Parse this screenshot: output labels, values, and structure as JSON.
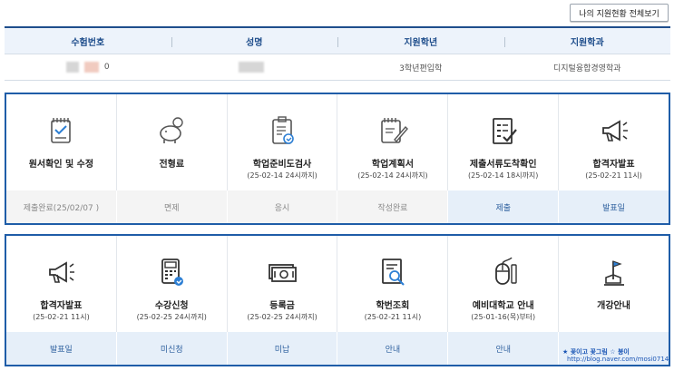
{
  "top_button": "나의 지원현황 전체보기",
  "info": {
    "headers": [
      "수험번호",
      "성명",
      "지원학년",
      "지원학과"
    ],
    "values": {
      "exam_no_suffix": "0",
      "grade": "3학년편입학",
      "dept": "디지털융합경영학과"
    }
  },
  "panel1": [
    {
      "title": "원서확인 및 수정",
      "sub": "",
      "status": "제출완료(25/02/07 )",
      "style": "gray",
      "icon": "clipboard-check-icon"
    },
    {
      "title": "전형료",
      "sub": "",
      "status": "면제",
      "style": "gray",
      "icon": "piggy-bank-icon"
    },
    {
      "title": "학업준비도검사",
      "sub": "(25-02-14 24시까지)",
      "status": "응시",
      "style": "gray",
      "icon": "test-clipboard-icon"
    },
    {
      "title": "학업계획서",
      "sub": "(25-02-14 24시까지)",
      "status": "작성완료",
      "style": "gray",
      "icon": "notepad-pencil-icon"
    },
    {
      "title": "제출서류도착확인",
      "sub": "(25-02-14 18시까지)",
      "status": "제출",
      "style": "blue",
      "icon": "checklist-icon"
    },
    {
      "title": "합격자발표",
      "sub": "(25-02-21 11시)",
      "status": "발표일",
      "style": "blue",
      "icon": "megaphone-icon"
    }
  ],
  "panel2": [
    {
      "title": "합격자발표",
      "sub": "(25-02-21 11시)",
      "status": "발표일",
      "style": "blue",
      "icon": "megaphone-icon"
    },
    {
      "title": "수강신청",
      "sub": "(25-02-25 24시까지)",
      "status": "미신청",
      "style": "blue",
      "icon": "calculator-icon"
    },
    {
      "title": "등록금",
      "sub": "(25-02-25 24시까지)",
      "status": "미납",
      "style": "blue",
      "icon": "money-icon"
    },
    {
      "title": "학번조회",
      "sub": "(25-02-21 11시)",
      "status": "안내",
      "style": "blue",
      "icon": "id-search-icon"
    },
    {
      "title": "예비대학교 안내",
      "sub": "(25-01-16(목)부터)",
      "status": "안내",
      "style": "blue",
      "icon": "mouse-icon"
    },
    {
      "title": "개강안내",
      "sub": "",
      "status": "",
      "style": "blue",
      "icon": "flag-icon"
    }
  ],
  "watermark": {
    "line1": "★ 꽃이고 꽃그림 ☆ 봉이",
    "line2": "http://blog.naver.com/mosi0714"
  }
}
